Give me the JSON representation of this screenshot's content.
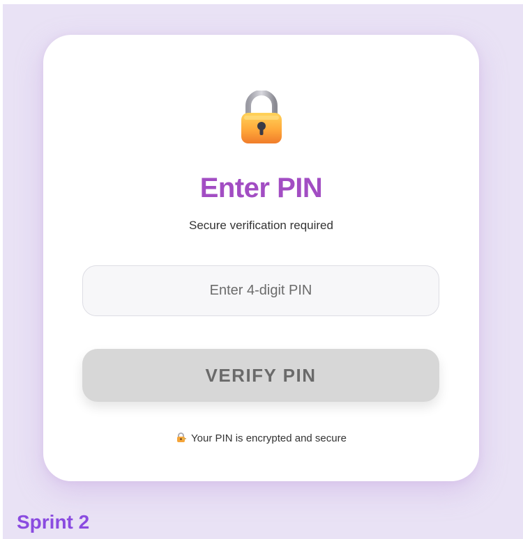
{
  "card": {
    "icon": "lock-icon",
    "title": "Enter PIN",
    "subtitle": "Secure verification required",
    "pin_input": {
      "value": "",
      "placeholder": "Enter 4-digit PIN"
    },
    "verify_button_label": "VERIFY PIN",
    "secure_note": {
      "icon": "lock-with-key-icon",
      "text": "Your PIN is encrypted and secure"
    }
  },
  "footer_label": "Sprint 2",
  "colors": {
    "background": "#e9e2f5",
    "title": "#a24dc3",
    "button_disabled": "#d7d7d7",
    "sprint_label": "#8a4be0"
  }
}
